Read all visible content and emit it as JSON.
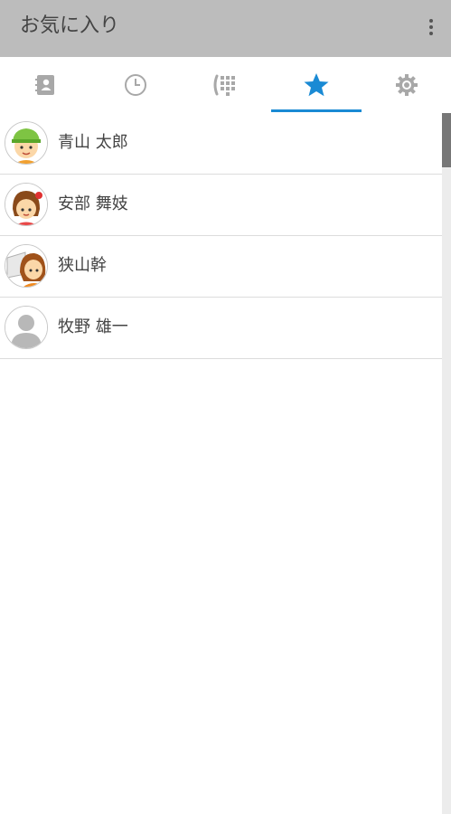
{
  "appbar": {
    "title": "お気に入り",
    "menu_icon": "more-vert-icon"
  },
  "tabs": [
    {
      "name": "contacts",
      "icon": "address-book-icon",
      "selected": false
    },
    {
      "name": "history",
      "icon": "clock-icon",
      "selected": false
    },
    {
      "name": "dialpad",
      "icon": "dialpad-icon",
      "selected": false
    },
    {
      "name": "favorites",
      "icon": "star-icon",
      "selected": true
    },
    {
      "name": "settings",
      "icon": "gear-icon",
      "selected": false
    }
  ],
  "colors": {
    "appbar_bg": "#bcbcbc",
    "accent": "#1a8ad4",
    "icon_inactive": "#a8a8a8",
    "text": "#444444"
  },
  "favorites": [
    {
      "name": "青山 太郎",
      "avatar": "boy-green-cap-avatar"
    },
    {
      "name": "安部 舞妓",
      "avatar": "girl-red-bow-avatar"
    },
    {
      "name": "狭山幹",
      "avatar": "girl-brown-hair-avatar"
    },
    {
      "name": "牧野 雄一",
      "avatar": "default-person-avatar"
    }
  ]
}
